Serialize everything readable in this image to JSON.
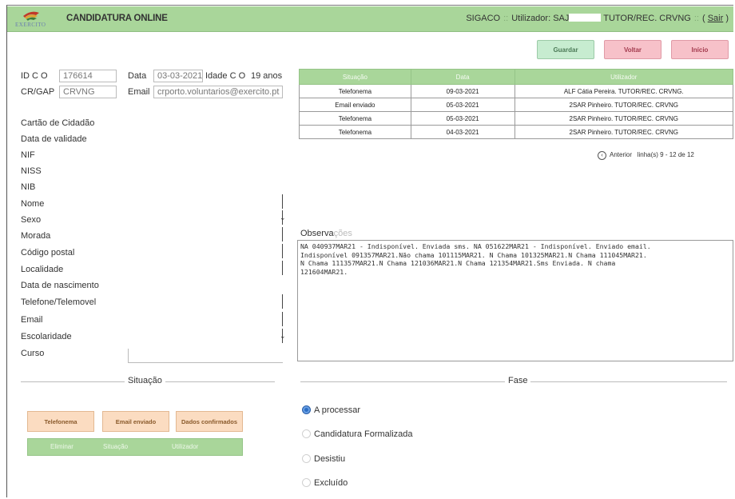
{
  "header": {
    "logo_text": "EXERCITO",
    "title": "CANDIDATURA ONLINE",
    "system": "SIGACO",
    "user_prefix": "Utilizador: SAJ",
    "user_role": "TUTOR/REC. CRVNG",
    "logout_label": "Sair"
  },
  "toolbar": {
    "save_label": "Guardar",
    "back_label": "Voltar",
    "home_label": "Início"
  },
  "form": {
    "idco_label": "ID C O",
    "idco_value": "176614",
    "data_label": "Data",
    "data_value": "03-03-2021",
    "idade_label": "Idade C O",
    "idade_value": "19 anos",
    "crgap_label": "CR/GAP",
    "crgap_value": "CRVNG",
    "email_top_label": "Email",
    "email_top_value": "crporto.voluntarios@exercito.pt",
    "fields": {
      "cartao": "Cartão de Cidadão",
      "validade": "Data de validade",
      "nif": "NIF",
      "niss": "NISS",
      "nib": "NIB",
      "nome": "Nome",
      "sexo": "Sexo",
      "morada": "Morada",
      "codigo_postal": "Código postal",
      "localidade": "Localidade",
      "nascimento": "Data de nascimento",
      "telefone": "Telefone/Telemovel",
      "email": "Email",
      "escolaridade": "Escolaridade",
      "curso": "Curso"
    }
  },
  "history": {
    "headers": [
      "Situação",
      "Data",
      "Utilizador"
    ],
    "rows": [
      [
        "Telefonema",
        "09-03-2021",
        "ALF Cátia Pereira. TUTOR/REC. CRVNG."
      ],
      [
        "Email enviado",
        "05-03-2021",
        "2SAR Pinheiro. TUTOR/REC. CRVNG"
      ],
      [
        "Telefonema",
        "05-03-2021",
        "2SAR Pinheiro. TUTOR/REC. CRVNG"
      ],
      [
        "Telefonema",
        "04-03-2021",
        "2SAR Pinheiro. TUTOR/REC. CRVNG"
      ]
    ],
    "pager_prev": "Anterior",
    "pager_info": "linha(s) 9 - 12 de 12"
  },
  "observations": {
    "label": "Observações",
    "label_faint": "ções",
    "text": "NA 040937MAR21 - Indisponível. Enviada sms. NA 051622MAR21 - Indisponível. Enviado email.\nIndisponível 091357MAR21.Não chama 101115MAR21. N Chama 101325MAR21.N Chama 111045MAR21.\nN Chama 111357MAR21.N Chama 121036MAR21.N Chama 121354MAR21.Sms Enviada. N chama\n121604MAR21."
  },
  "situacao": {
    "title": "Situação",
    "buttons": [
      "Telefonema",
      "Email enviado",
      "Dados confirmados"
    ],
    "table_headers": [
      "Eliminar",
      "Situação",
      "Utilizador"
    ]
  },
  "fase": {
    "title": "Fase",
    "options": [
      "A processar",
      "Candidatura Formalizada",
      "Desistiu",
      "Excluído"
    ],
    "selected": "A processar"
  },
  "colors": {
    "header_green": "#a9d69a",
    "save_green": "#c7ecd0",
    "back_pink": "#f7c1c9",
    "status_orange": "#fbdcc1",
    "radio_blue": "#2d6fc5"
  }
}
